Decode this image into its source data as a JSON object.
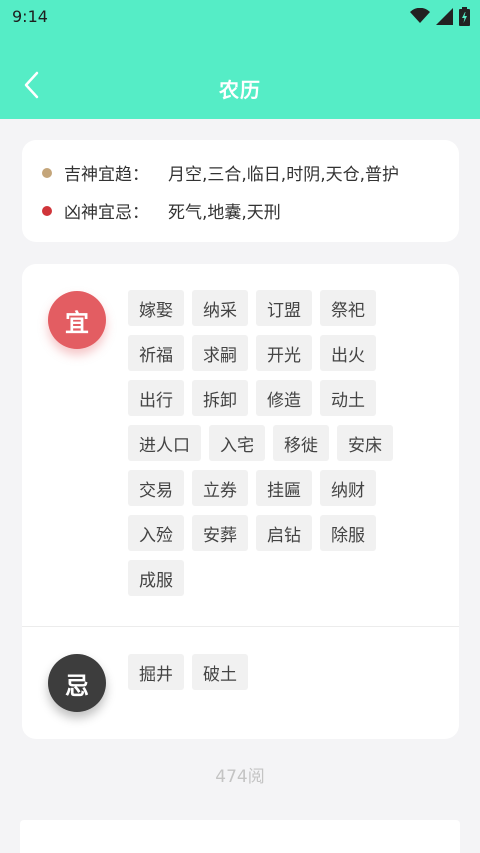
{
  "status_bar": {
    "time": "9:14"
  },
  "app_bar": {
    "title": "农历"
  },
  "auspicious_gods": {
    "label": "吉神宜趋：",
    "value": "月空,三合,临日,时阴,天仓,普护",
    "dot_color": "#c4a57a"
  },
  "inauspicious_gods": {
    "label": "凶神宜忌：",
    "value": "死气,地囊,天刑",
    "dot_color": "#d0353a"
  },
  "yi": {
    "badge": "宜",
    "items": [
      "嫁娶",
      "纳采",
      "订盟",
      "祭祀",
      "祈福",
      "求嗣",
      "开光",
      "出火",
      "出行",
      "拆卸",
      "修造",
      "动土",
      "进人口",
      "入宅",
      "移徙",
      "安床",
      "交易",
      "立券",
      "挂匾",
      "纳财",
      "入殓",
      "安葬",
      "启钻",
      "除服",
      "成服"
    ]
  },
  "ji": {
    "badge": "忌",
    "items": [
      "掘井",
      "破土"
    ]
  },
  "read_count": "474阅"
}
